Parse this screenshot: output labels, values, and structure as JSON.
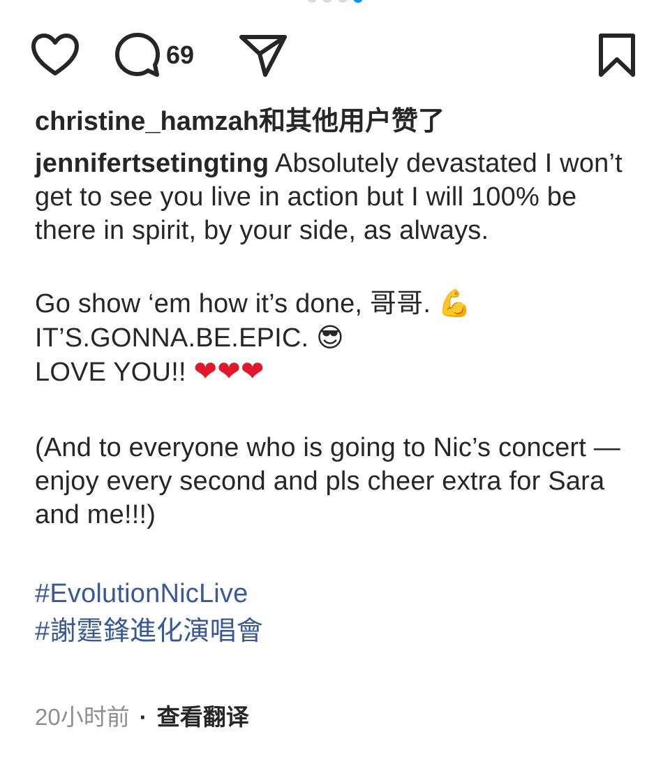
{
  "carousel": {
    "count": 4,
    "active_index": 3
  },
  "actions": {
    "like_icon": "heart-outline-icon",
    "comment_icon": "comment-bubble-icon",
    "comment_count": "69",
    "share_icon": "paper-plane-icon",
    "save_icon": "bookmark-outline-icon"
  },
  "likes": {
    "username": "christine_hamzah",
    "suffix": "和其他用户赞了"
  },
  "caption": {
    "username": "jennifertsetingting",
    "para1": " Absolutely devastated I won’t get to see you live in action but I will 100% be there in spirit, by your side, as always.",
    "line_go": "Go show ‘em how it’s done, 哥哥. ",
    "emoji_muscle": "💪",
    "line_epic": "IT’S.GONNA.BE.EPIC. ",
    "emoji_sunglasses": "😎",
    "line_love": "LOVE YOU!! ",
    "hearts": "❤❤❤",
    "para3": "(And to everyone who is going to Nic’s concert — enjoy every second and pls cheer extra for Sara and me!!!)",
    "hashtags": [
      "#EvolutionNicLive",
      "#謝霆鋒進化演唱會"
    ]
  },
  "meta": {
    "time": "20小时前",
    "separator": "·",
    "translate": "查看翻译"
  },
  "colors": {
    "text": "#262626",
    "hashtag": "#385898",
    "muted": "#8e8e8e",
    "heart": "#e0182d",
    "active_dot": "#0095f6"
  }
}
